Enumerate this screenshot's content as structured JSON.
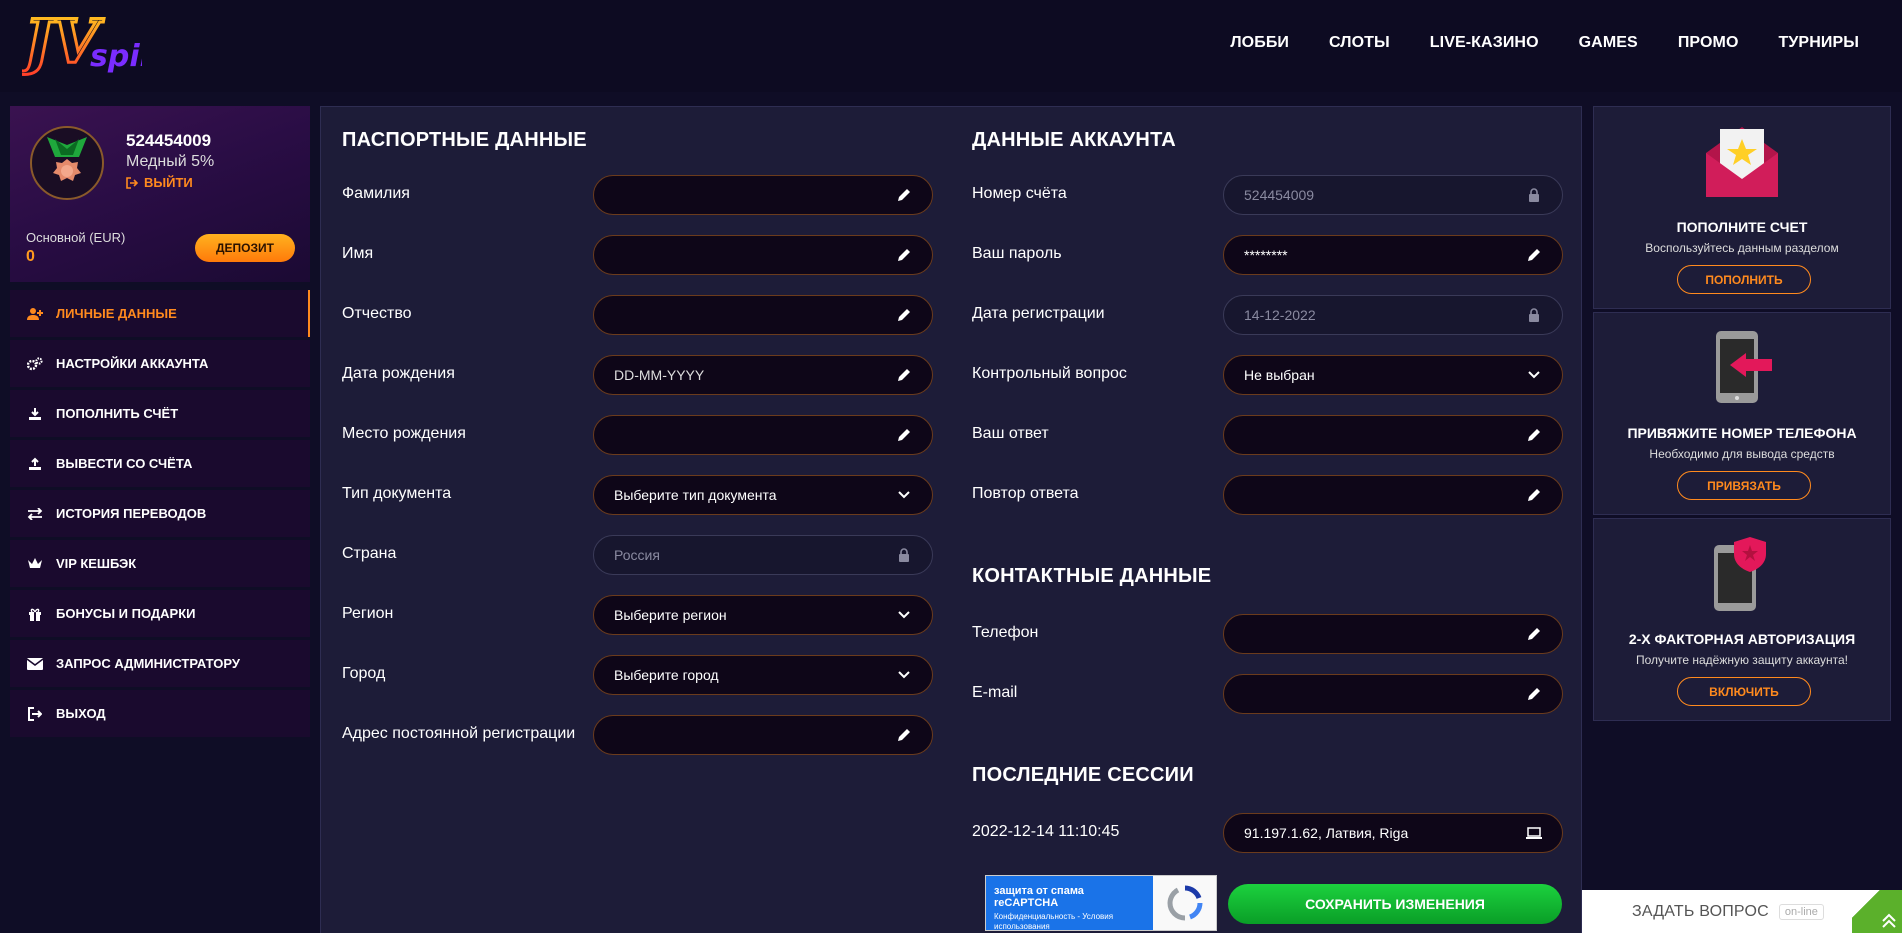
{
  "header": {
    "logo_text": "JV spin",
    "nav": [
      "ЛОББИ",
      "СЛОТЫ",
      "LIVE-КАЗИНО",
      "GAMES",
      "ПРОМО",
      "ТУРНИРЫ"
    ]
  },
  "profile": {
    "user_id": "524454009",
    "level": "Медный 5%",
    "logout": "ВЫЙТИ",
    "balance_label": "Основной (EUR)",
    "balance_value": "0",
    "deposit": "ДЕПОЗИТ"
  },
  "menu": [
    {
      "label": "ЛИЧНЫЕ ДАННЫЕ",
      "icon": "user-plus-icon",
      "active": true
    },
    {
      "label": "НАСТРОЙКИ АККАУНТА",
      "icon": "gears-icon"
    },
    {
      "label": "ПОПОЛНИТЬ СЧЁТ",
      "icon": "download-icon"
    },
    {
      "label": "ВЫВЕСТИ СО СЧЁТА",
      "icon": "upload-icon"
    },
    {
      "label": "ИСТОРИЯ ПЕРЕВОДОВ",
      "icon": "exchange-icon"
    },
    {
      "label": "VIP КЕШБЭК",
      "icon": "crown-icon"
    },
    {
      "label": "БОНУСЫ И ПОДАРКИ",
      "icon": "gift-icon"
    },
    {
      "label": "ЗАПРОС АДМИНИСТРАТОРУ",
      "icon": "envelope-icon"
    },
    {
      "label": "ВЫХОД",
      "icon": "sign-out-icon"
    }
  ],
  "passport": {
    "title": "ПАСПОРТНЫЕ ДАННЫЕ",
    "fields": [
      {
        "label": "Фамилия",
        "value": "",
        "type": "edit"
      },
      {
        "label": "Имя",
        "value": "",
        "type": "edit"
      },
      {
        "label": "Отчество",
        "value": "",
        "type": "edit"
      },
      {
        "label": "Дата рождения",
        "value": "DD-MM-YYYY",
        "type": "edit"
      },
      {
        "label": "Место рождения",
        "value": "",
        "type": "edit"
      },
      {
        "label": "Тип документа",
        "value": "Выберите тип документа",
        "type": "select"
      },
      {
        "label": "Страна",
        "value": "Россия",
        "type": "locked"
      },
      {
        "label": "Регион",
        "value": "Выберите регион",
        "type": "select"
      },
      {
        "label": "Город",
        "value": "Выберите город",
        "type": "select"
      },
      {
        "label": "Адрес постоянной регистрации",
        "value": "",
        "type": "edit"
      }
    ]
  },
  "account": {
    "title": "ДАННЫЕ АККАУНТА",
    "fields": [
      {
        "label": "Номер счёта",
        "value": "524454009",
        "type": "locked"
      },
      {
        "label": "Ваш пароль",
        "value": "********",
        "type": "edit"
      },
      {
        "label": "Дата регистрации",
        "value": "14-12-2022",
        "type": "locked"
      },
      {
        "label": "Контрольный вопрос",
        "value": "Не выбран",
        "type": "select"
      },
      {
        "label": "Ваш ответ",
        "value": "",
        "type": "edit"
      },
      {
        "label": "Повтор ответа",
        "value": "",
        "type": "edit"
      }
    ]
  },
  "contacts": {
    "title": "КОНТАКТНЫЕ ДАННЫЕ",
    "fields": [
      {
        "label": "Телефон",
        "value": "",
        "type": "edit"
      },
      {
        "label": "E-mail",
        "value": "",
        "type": "edit"
      }
    ]
  },
  "sessions": {
    "title": "ПОСЛЕДНИЕ СЕССИИ",
    "rows": [
      {
        "time": "2022-12-14 11:10:45",
        "value": "91.197.1.62, Латвия, Riga"
      }
    ]
  },
  "recaptcha": {
    "title": "защита от спама reCAPTCHA",
    "sub": "Конфиденциальность - Условия использования"
  },
  "save": "СОХРАНИТЬ ИЗМЕНЕНИЯ",
  "promos": [
    {
      "title": "ПОПОЛНИТЕ СЧЕТ",
      "sub": "Воспользуйтесь данным разделом",
      "button": "ПОПОЛНИТЬ",
      "icon": "envelope-star-icon"
    },
    {
      "title": "ПРИВЯЖИТЕ НОМЕР ТЕЛЕФОНА",
      "sub": "Необходимо для вывода средств",
      "button": "ПРИВЯЗАТЬ",
      "icon": "phone-arrow-icon"
    },
    {
      "title": "2-Х ФАКТОРНАЯ АВТОРИЗАЦИЯ",
      "sub": "Получите надёжную защиту аккаунта!",
      "button": "ВКЛЮЧИТЬ",
      "icon": "phone-shield-icon"
    }
  ],
  "ask": {
    "text": "ЗАДАТЬ ВОПРОС",
    "status": "on-line"
  },
  "colors": {
    "accent": "#ff8a1e",
    "panel": "#1d1c38",
    "save": "#13b834"
  }
}
